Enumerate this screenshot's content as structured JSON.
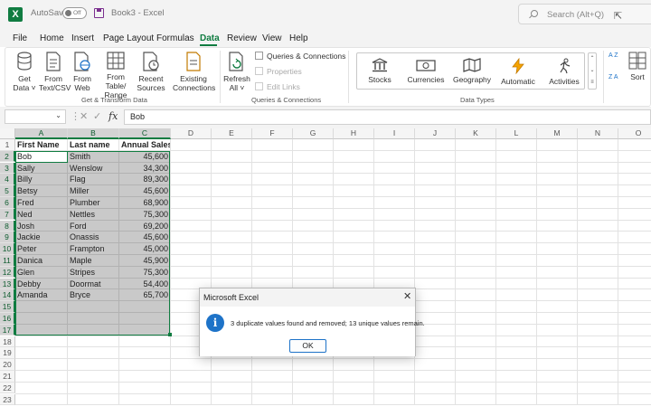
{
  "titlebar": {
    "app_logo": "X",
    "autosave_label": "AutoSave",
    "autosave_state": "Off",
    "document": "Book3 - Excel",
    "search_placeholder": "Search (Alt+Q)"
  },
  "menu": {
    "items": [
      "File",
      "Home",
      "Insert",
      "Page Layout",
      "Formulas",
      "Data",
      "Review",
      "View",
      "Help"
    ],
    "active": "Data"
  },
  "ribbon": {
    "get_transform": {
      "label": "Get & Transform Data",
      "buttons": [
        "Get Data ˅",
        "From Text/CSV",
        "From Web",
        "From Table/ Range",
        "Recent Sources",
        "Existing Connections"
      ]
    },
    "queries": {
      "label": "Queries & Connections",
      "refresh": "Refresh All ˅",
      "items": [
        "Queries & Connections",
        "Properties",
        "Edit Links"
      ]
    },
    "data_types": {
      "label": "Data Types",
      "items": [
        "Stocks",
        "Currencies",
        "Geography",
        "Automatic",
        "Activities"
      ]
    },
    "sort": {
      "label": "Sort",
      "az": "A Z",
      "za": "Z A"
    }
  },
  "formula_bar": {
    "namebox": "",
    "fx": "fx",
    "value": "Bob"
  },
  "sheet": {
    "columns": [
      "A",
      "B",
      "C",
      "D",
      "E",
      "F",
      "G",
      "H",
      "I",
      "J",
      "K",
      "L",
      "M",
      "N",
      "O"
    ],
    "rows": [
      "1",
      "2",
      "3",
      "4",
      "5",
      "6",
      "7",
      "8",
      "9",
      "10",
      "11",
      "12",
      "13",
      "14",
      "15",
      "16",
      "17",
      "18",
      "19",
      "20",
      "21",
      "22",
      "23"
    ],
    "headers": [
      "First Name",
      "Last name",
      "Annual Sales"
    ],
    "data": [
      [
        "Bob",
        "Smith",
        "45,600"
      ],
      [
        "Sally",
        "Wenslow",
        "34,300"
      ],
      [
        "Billy",
        "Flag",
        "89,300"
      ],
      [
        "Betsy",
        "Miller",
        "45,600"
      ],
      [
        "Fred",
        "Plumber",
        "68,900"
      ],
      [
        "Ned",
        "Nettles",
        "75,300"
      ],
      [
        "Josh",
        "Ford",
        "69,200"
      ],
      [
        "Jackie",
        "Onassis",
        "45,600"
      ],
      [
        "Peter",
        "Frampton",
        "45,000"
      ],
      [
        "Danica",
        "Maple",
        "45,900"
      ],
      [
        "Glen",
        "Stripes",
        "75,300"
      ],
      [
        "Debby",
        "Doormat",
        "54,400"
      ],
      [
        "Amanda",
        "Bryce",
        "65,700"
      ]
    ]
  },
  "dialog": {
    "title": "Microsoft Excel",
    "close": "✕",
    "icon": "i",
    "message": "3 duplicate values found and removed; 13 unique values remain.",
    "ok": "OK"
  },
  "colors": {
    "excel_green": "#107c41",
    "info_blue": "#1e73c8"
  }
}
